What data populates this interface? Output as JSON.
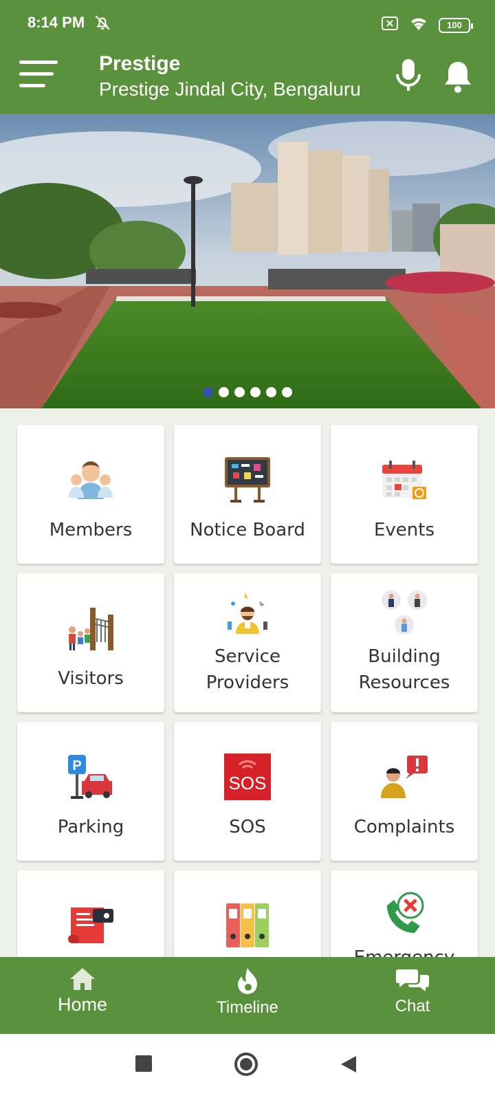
{
  "status_bar": {
    "time": "8:14 PM",
    "battery": "100",
    "icons": [
      "bell-off-icon",
      "sim-off-icon",
      "wifi-icon",
      "battery-icon"
    ]
  },
  "header": {
    "title": "Prestige",
    "subtitle": "Prestige Jindal City, Bengaluru",
    "icons": [
      "menu-icon",
      "microphone-icon",
      "notification-bell-icon"
    ]
  },
  "banner": {
    "slide_count": 6,
    "active_slide": 1
  },
  "tiles": [
    {
      "label": "Members",
      "icon": "members-icon"
    },
    {
      "label": "Notice Board",
      "icon": "notice-board-icon"
    },
    {
      "label": "Events",
      "icon": "calendar-icon"
    },
    {
      "label": "Visitors",
      "icon": "visitors-gate-icon"
    },
    {
      "label": "Service\nProviders",
      "icon": "service-provider-icon"
    },
    {
      "label": "Building\nResources",
      "icon": "building-staff-icon"
    },
    {
      "label": "Parking",
      "icon": "parking-car-icon"
    },
    {
      "label": "SOS",
      "icon": "sos-icon"
    },
    {
      "label": "Complaints",
      "icon": "complaint-icon"
    },
    {
      "label": "",
      "icon": "bill-scroll-icon"
    },
    {
      "label": "",
      "icon": "documents-binder-icon"
    },
    {
      "label": "Emergency",
      "icon": "emergency-call-icon"
    }
  ],
  "sos_text": "SOS",
  "bottom_nav": [
    {
      "label": "Home",
      "icon": "home-icon"
    },
    {
      "label": "Timeline",
      "icon": "flame-icon"
    },
    {
      "label": "Chat",
      "icon": "chat-bubbles-icon"
    }
  ],
  "colors": {
    "primary": "#5a913c",
    "background": "#eef0ea",
    "active_dot": "#3b4fb3"
  }
}
